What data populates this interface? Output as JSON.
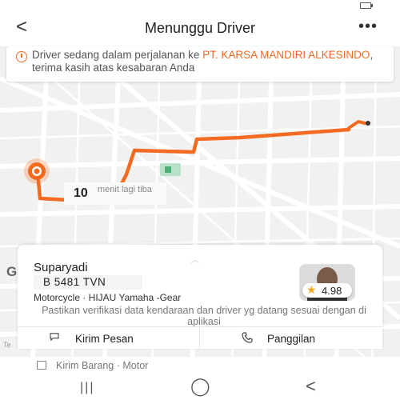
{
  "header": {
    "back_icon": "chevron-left-icon",
    "back_glyph": "<",
    "title": "Menunggu Driver",
    "more_glyph": "•••"
  },
  "banner": {
    "icon": "clock-icon",
    "text_before": "Driver sedang dalam perjalanan ke ",
    "highlight": "PT. KARSA MANDIRI ALKESINDO",
    "text_after": ", terima kasih atas kesabaran Anda",
    "highlight_color": "#f26b21"
  },
  "map": {
    "eta_minutes": "10",
    "eta_label": "menit lagi tiba",
    "watermark": "Google",
    "street_label": "Te",
    "route_color": "#f26b21"
  },
  "driver": {
    "name": "Suparyadi",
    "plate": "B 5481 TVN",
    "vehicle": "Motorcycle · HIJAU Yamaha -Gear",
    "rating": "4.98",
    "verification_note": "Pastikan verifikasi data kendaraan dan driver yg datang sesuai dengan di aplikasi",
    "handle_glyph": "︿"
  },
  "actions": {
    "message_label": "Kirim Pesan",
    "call_label": "Panggilan"
  },
  "service": {
    "label": "Kirim Barang · Motor"
  },
  "navbar": {
    "recents_glyph": "|||",
    "home_glyph": "◯",
    "back_glyph": "<"
  }
}
